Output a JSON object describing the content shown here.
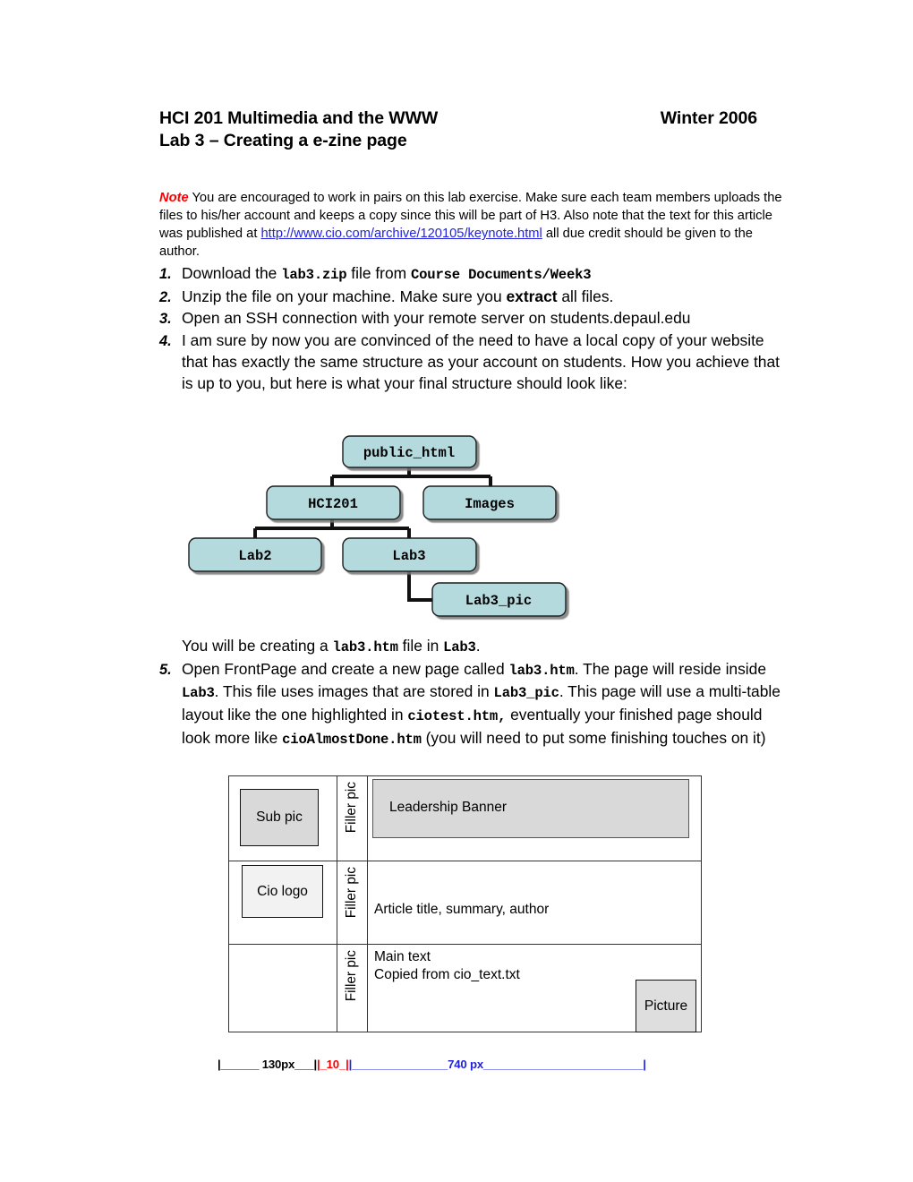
{
  "header": {
    "course_title": "HCI 201 Multimedia and the WWW",
    "term": "Winter 2006",
    "lab_title": "Lab 3 – Creating a e-zine page"
  },
  "note": {
    "label": "Note",
    "text_1": " You are encouraged to work in pairs on this lab exercise. Make sure each team members uploads the files to his/her account and keeps a copy since this will be part of H3. Also note that the text for this article was published at ",
    "url": "http://www.cio.com/archive/120105/keynote.html",
    "text_2": " all due credit should be given to the author."
  },
  "steps": [
    {
      "num": "1.",
      "parts": [
        {
          "t": "Download the ",
          "style": "normal"
        },
        {
          "t": "lab3.zip",
          "style": "mono"
        },
        {
          "t": " file from ",
          "style": "normal"
        },
        {
          "t": "Course Documents/Week3",
          "style": "mono"
        }
      ]
    },
    {
      "num": "2.",
      "parts": [
        {
          "t": "Unzip the file on your machine.  Make sure you ",
          "style": "normal"
        },
        {
          "t": "extract",
          "style": "bold"
        },
        {
          "t": " all files.",
          "style": "normal"
        }
      ]
    },
    {
      "num": "3.",
      "parts": [
        {
          "t": "Open an SSH connection with your remote server on students.depaul.edu",
          "style": "normal"
        }
      ]
    },
    {
      "num": "4.",
      "parts": [
        {
          "t": "I am sure by now you are convinced of the need to have a local copy of your website that has exactly the same structure as your account on students. How you achieve that is up to you, but here is what your final structure should look like:",
          "style": "normal"
        }
      ]
    }
  ],
  "tree": {
    "fill_color": "#b4dade",
    "stroke_color": "#1a1a1a",
    "nodes": [
      {
        "id": "public_html",
        "label": "public_html"
      },
      {
        "id": "hci201",
        "label": "HCI201"
      },
      {
        "id": "images",
        "label": "Images"
      },
      {
        "id": "lab2",
        "label": "Lab2"
      },
      {
        "id": "lab3",
        "label": "Lab3"
      },
      {
        "id": "lab3_pic",
        "label": "Lab3_pic"
      }
    ]
  },
  "mid_text": {
    "lead_parts": [
      {
        "t": "You will be creating a ",
        "style": "normal"
      },
      {
        "t": "lab3.htm",
        "style": "mono"
      },
      {
        "t": " file in ",
        "style": "normal"
      },
      {
        "t": "Lab3",
        "style": "mono"
      },
      {
        "t": ".",
        "style": "normal"
      }
    ],
    "step5": {
      "num": "5.",
      "parts": [
        {
          "t": "Open FrontPage and create a new page called ",
          "style": "normal"
        },
        {
          "t": "lab3.htm",
          "style": "mono"
        },
        {
          "t": ". The page will reside inside ",
          "style": "normal"
        },
        {
          "t": "Lab3",
          "style": "mono"
        },
        {
          "t": ". This file uses images that are stored in ",
          "style": "normal"
        },
        {
          "t": "Lab3_pic",
          "style": "mono"
        },
        {
          "t": ". This page will use a multi-table layout like the one highlighted in ",
          "style": "normal"
        },
        {
          "t": "ciotest.htm,",
          "style": "mono"
        },
        {
          "t": " eventually your finished page should look more like ",
          "style": "normal"
        },
        {
          "t": "cioAlmostDone.htm",
          "style": "mono"
        },
        {
          "t": " (you will need to put some finishing touches on it)",
          "style": "normal"
        }
      ]
    }
  },
  "layout_diagram": {
    "filler_label": "Filler pic",
    "sub_pic": "Sub pic",
    "cio_logo": "Cio logo",
    "leadership_banner": "Leadership Banner",
    "article_line": "Article title, summary, author",
    "main_text_line_1": "Main text",
    "main_text_line_2": "Copied from cio_text.txt",
    "picture": "Picture"
  },
  "ruler": {
    "seg_left": "|______ 130px___|",
    "seg_mid": "|_10_|",
    "seg_right_a": "|_______________",
    "seg_right_label": "740 px",
    "seg_right_b": "_________________________|",
    "colors": {
      "left": "#000000",
      "mid": "#ff0000",
      "right": "#2222dd"
    }
  }
}
